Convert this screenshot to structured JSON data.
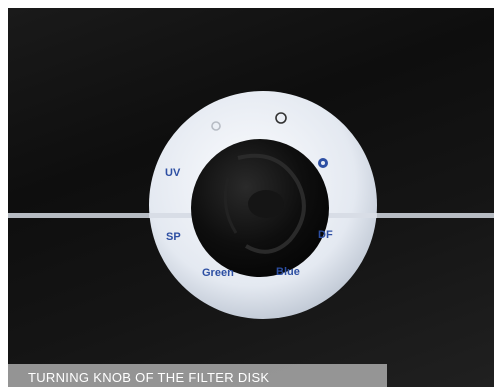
{
  "photo": {
    "subject": "filter-disk-turning-knob",
    "disk_labels": {
      "uv": "UV",
      "sp": "SP",
      "df": "DF",
      "green": "Green",
      "blue": "Blue"
    },
    "colors": {
      "background": "#141414",
      "disk": "#e8edf4",
      "label_blue": "#2d4fa3",
      "knob": "#0b0b0b"
    }
  },
  "caption": {
    "text": "TURNING KNOB OF THE FILTER DISK"
  }
}
